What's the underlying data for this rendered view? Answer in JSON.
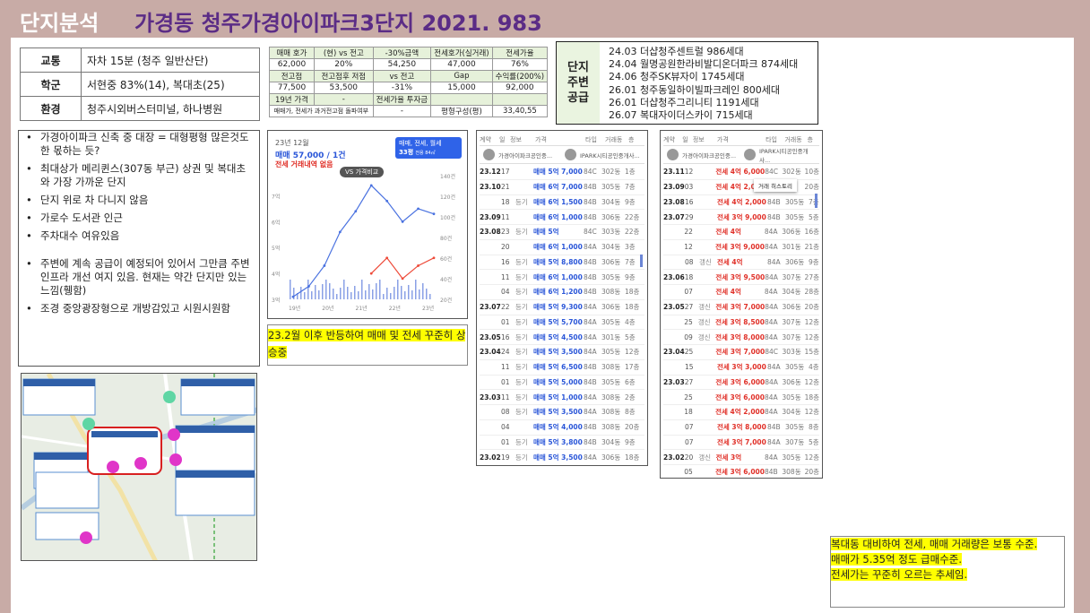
{
  "header": {
    "label": "단지분석",
    "title": "가경동 청주가경아이파크3단지 2021. 983"
  },
  "info": [
    {
      "k": "교통",
      "v": "자차 15분 (청주 일반산단)"
    },
    {
      "k": "학군",
      "v": "서현중 83%(14), 복대초(25)"
    },
    {
      "k": "환경",
      "v": "청주시외버스터미널, 하나병원"
    }
  ],
  "price_table": {
    "r1": [
      "매매 호가",
      "(현) vs 전고",
      "-30%금액",
      "전세호가(실거래)",
      "전세가율"
    ],
    "r2": [
      "62,000",
      "20%",
      "54,250",
      "47,000",
      "76%"
    ],
    "r3": [
      "전고점",
      "전고점후 저점",
      "vs 전고",
      "Gap",
      "수익률(200%)"
    ],
    "r4": [
      "77,500",
      "53,500",
      "-31%",
      "15,000",
      "92,000"
    ],
    "r5": [
      "19년 가격",
      "-",
      "전세가율 투자금",
      "",
      ""
    ],
    "r6": [
      "매매가, 전세가 과거전고점 돌파여부",
      "-",
      "평형구성(평)",
      "33,40,55"
    ]
  },
  "supply": {
    "label_lines": [
      "단지",
      "주변",
      "공급"
    ],
    "items": [
      "24.03 더샵청주센트럴 986세대",
      "24.04 월명공원한라비발디온더파크 874세대",
      "24.06  청주SK뷰자이 1745세대",
      "26.01 청주동일하이빌파크레인 800세대",
      "26.01 더샵청주그리니티 1191세대",
      "26.07 복대자이더스카이 715세대"
    ]
  },
  "bullets": [
    "가경아이파크 신축 중 대장 = 대형평형 많은것도 한 몫하는 듯?",
    "최대상가 메리퀸스(307동 부근) 상권 및 복대초와 가장 가까운 단지",
    "단지 위로 차 다니지 않음",
    "가로수 도서관 인근",
    "주차대수 여유있음",
    "주변에 계속 공급이 예정되어 있어서 그만큼 주변 인프라 개선 여지 있음. 현재는 약간 단지만 있는 느낌(휑함)",
    "조경 중앙광장형으로 개방감있고 시원시원함"
  ],
  "chart_card": {
    "date": "23년 12월",
    "price": "매매 57,000 / 1건",
    "sub": "전세 거래내역 없음",
    "compare": "VS 가격비교",
    "filter": "매매, 전세, 월세",
    "count": "33평",
    "count_sub": "전용 84㎡"
  },
  "chart_data": {
    "type": "line",
    "x": [
      "19년",
      "20년",
      "21년",
      "22년",
      "23년"
    ],
    "y_left_ticks": [
      "7억",
      "6억",
      "5억",
      "4억",
      "3억"
    ],
    "y_right_ticks": [
      "140건",
      "120건",
      "100건",
      "80건",
      "60건",
      "40건",
      "20건"
    ],
    "series": [
      {
        "name": "매매",
        "values": [
          3.1,
          3.5,
          4.3,
          5.6,
          6.4,
          7.4,
          6.8,
          6.0,
          6.5,
          6.3
        ]
      },
      {
        "name": "전세",
        "values": [
          null,
          null,
          null,
          null,
          null,
          4.0,
          4.6,
          3.8,
          4.3,
          4.6
        ]
      }
    ]
  },
  "chart_note": "23.2월 이후 반등하여 매매 및 전세 꾸준히 상승중",
  "list_header": [
    "계약",
    "일",
    "정보",
    "가격",
    "타입",
    "거래동",
    "층"
  ],
  "agents": [
    "가경아이파크공인중...",
    "IPARK시티공인중개사..."
  ],
  "sale_list": [
    [
      "23.12",
      "17",
      "",
      "매매 5억 7,000",
      "84C",
      "302동",
      "1층"
    ],
    [
      "23.10",
      "21",
      "",
      "매매 6억 7,000",
      "84B",
      "305동",
      "7층"
    ],
    [
      "",
      "18",
      "등기",
      "매매 6억 1,500",
      "84B",
      "304동",
      "9층"
    ],
    [
      "23.09",
      "11",
      "",
      "매매 6억 1,000",
      "84B",
      "306동",
      "22층"
    ],
    [
      "23.08",
      "23",
      "등기",
      "매매 5억",
      "84C",
      "303동",
      "22층"
    ],
    [
      "",
      "20",
      "",
      "매매 6억 1,000",
      "84A",
      "304동",
      "3층"
    ],
    [
      "",
      "16",
      "등기",
      "매매 5억 8,800",
      "84B",
      "306동",
      "7층"
    ],
    [
      "",
      "11",
      "등기",
      "매매 6억 1,000",
      "84B",
      "305동",
      "9층"
    ],
    [
      "",
      "04",
      "등기",
      "매매 6억 1,200",
      "84B",
      "308동",
      "18층"
    ],
    [
      "23.07",
      "22",
      "등기",
      "매매 5억 9,300",
      "84A",
      "306동",
      "18층"
    ],
    [
      "",
      "01",
      "등기",
      "매매 5억 5,700",
      "84A",
      "305동",
      "4층"
    ],
    [
      "23.05",
      "16",
      "등기",
      "매매 5억 4,500",
      "84A",
      "301동",
      "5층"
    ],
    [
      "23.04",
      "24",
      "등기",
      "매매 5억 3,500",
      "84A",
      "305동",
      "12층"
    ],
    [
      "",
      "11",
      "등기",
      "매매 5억 6,500",
      "84B",
      "308동",
      "17층"
    ],
    [
      "",
      "01",
      "등기",
      "매매 5억 5,000",
      "84B",
      "305동",
      "6층"
    ],
    [
      "23.03",
      "11",
      "등기",
      "매매 5억 1,000",
      "84A",
      "308동",
      "2층"
    ],
    [
      "",
      "08",
      "등기",
      "매매 5억 3,500",
      "84A",
      "308동",
      "8층"
    ],
    [
      "",
      "04",
      "",
      "매매 5억 4,000",
      "84B",
      "308동",
      "20층"
    ],
    [
      "",
      "01",
      "등기",
      "매매 5억 3,800",
      "84B",
      "304동",
      "9층"
    ],
    [
      "23.02",
      "19",
      "등기",
      "매매 5억 3,500",
      "84A",
      "306동",
      "18층"
    ]
  ],
  "lease_list": [
    [
      "23.11",
      "12",
      "",
      "전세 4억 6,000",
      "84C",
      "302동",
      "10층"
    ],
    [
      "23.09",
      "03",
      "",
      "전세 4억 2,000",
      "84A",
      "",
      "20층"
    ],
    [
      "23.08",
      "16",
      "",
      "전세 4억 2,000",
      "84B",
      "305동",
      "7층"
    ],
    [
      "23.07",
      "29",
      "",
      "전세 3억 9,000",
      "84B",
      "305동",
      "5층"
    ],
    [
      "",
      "22",
      "",
      "전세 4억",
      "84A",
      "306동",
      "16층"
    ],
    [
      "",
      "12",
      "",
      "전세 3억 9,000",
      "84A",
      "301동",
      "21층"
    ],
    [
      "",
      "08",
      "갱신",
      "전세 4억",
      "84A",
      "306동",
      "9층"
    ],
    [
      "23.06",
      "18",
      "",
      "전세 3억 9,500",
      "84A",
      "307동",
      "27층"
    ],
    [
      "",
      "07",
      "",
      "전세 4억",
      "84A",
      "304동",
      "28층"
    ],
    [
      "23.05",
      "27",
      "갱신",
      "전세 3억 7,000",
      "84A",
      "306동",
      "20층"
    ],
    [
      "",
      "25",
      "갱신",
      "전세 3억 8,500",
      "84A",
      "307동",
      "12층"
    ],
    [
      "",
      "09",
      "갱신",
      "전세 3억 8,000",
      "84A",
      "307동",
      "12층"
    ],
    [
      "23.04",
      "25",
      "",
      "전세 3억 7,000",
      "84C",
      "303동",
      "15층"
    ],
    [
      "",
      "15",
      "",
      "전세 3억 3,000",
      "84A",
      "305동",
      "4층"
    ],
    [
      "23.03",
      "27",
      "",
      "전세 3억 6,000",
      "84A",
      "306동",
      "12층"
    ],
    [
      "",
      "25",
      "",
      "전세 3억 6,000",
      "84A",
      "305동",
      "18층"
    ],
    [
      "",
      "18",
      "",
      "전세 4억 2,000",
      "84A",
      "304동",
      "12층"
    ],
    [
      "",
      "07",
      "",
      "전세 3억 8,000",
      "84B",
      "305동",
      "8층"
    ],
    [
      "",
      "07",
      "",
      "전세 3억 7,000",
      "84A",
      "307동",
      "5층"
    ],
    [
      "23.02",
      "20",
      "갱신",
      "전세 3억",
      "84A",
      "305동",
      "12층"
    ],
    [
      "",
      "05",
      "",
      "전세 3억 6,000",
      "84B",
      "308동",
      "20층"
    ]
  ],
  "tooltip": "거래 히스토리",
  "summary": [
    "복대동 대비하여 전세, 매매 거래량은 보통 수준.",
    "매매가 5.35억 정도 급매수준.",
    "전세가는 꾸준히 오르는 추세임."
  ]
}
